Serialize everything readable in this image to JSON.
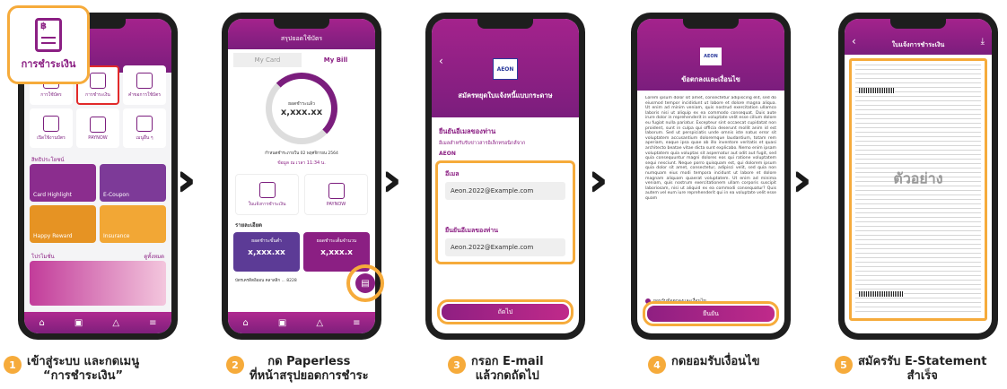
{
  "badge": {
    "label": "การชำระเงิน",
    "icon": "baht-document-icon"
  },
  "phone1": {
    "menu": [
      {
        "label": "การใช้บัตร"
      },
      {
        "label": "การชำระเงิน"
      },
      {
        "label": "คำขอการใช้บัตร"
      },
      {
        "label": "เปิดใช้งานบัตร"
      },
      {
        "label": "PAYNOW"
      },
      {
        "label": "เมนูอื่น ๆ"
      }
    ],
    "promo_title": "สิทธิประโยชน์",
    "promos": [
      {
        "label": "Card Highlight"
      },
      {
        "label": "E-Coupon"
      },
      {
        "label": "Happy Reward"
      },
      {
        "label": "Insurance"
      }
    ],
    "news_title": "โปรโมชั่น",
    "news_more": "ดูทั้งหมด"
  },
  "phone2": {
    "title": "สรุปยอดใช้บัตร",
    "tab_card": "My Card",
    "tab_bill": "My Bill",
    "ring_label": "ยอดชำระแล้ว",
    "ring_value": "x,xxx.xx",
    "due_text": "กำหนดชำระภายใน 02 พฤศจิกายน 2564",
    "update_text": "ข้อมูล ณ เวลา 11:34 น.",
    "btn_paperless": "ใบแจ้งการชำระเงิน",
    "btn_paynow": "PAYNOW",
    "detail_title": "รายละเอียด",
    "min_label": "ยอดชำระขั้นต่ำ",
    "min_value": "x,xxx.xx",
    "full_label": "ยอดชำระเต็มจำนวน",
    "full_value": "x,xxx.x",
    "footer_text": "บัตรเครดิตอิออน คลาสสิก ... 8228"
  },
  "phone3": {
    "logo": "AEON",
    "title": "สมัครหยุดใบแจ้งหนี้แบบกระดาษ",
    "confirm_title": "ยืนยันอีเมลของท่าน",
    "confirm_sub": "อีเมลสำหรับรับข่าวสารอิเล็กทรอนิกส์จาก",
    "brand": "AEON",
    "email_label": "อีเมล",
    "email_value": "Aeon.2022@Example.com",
    "confirm_label": "ยืนยันอีเมลของท่าน",
    "confirm_value": "Aeon.2022@Example.com",
    "next_button": "ถัดไป"
  },
  "phone4": {
    "logo": "AEON",
    "title": "ข้อตกลงและเงื่อนไข",
    "terms": "Lorem ipsum dolor sit amet, consectetur adipiscing elit, sed do eiusmod tempor incididunt ut labore et dolore magna aliqua. Ut enim ad minim veniam, quis nostrud exercitation ullamco laboris nisi ut aliquip ex ea commodo consequat. Duis aute irure dolor in reprehenderit in voluptate velit esse cillum dolore eu fugiat nulla pariatur. Excepteur sint occaecat cupidatat non proident, sunt in culpa qui officia deserunt mollit anim id est laborum. Sed ut perspiciatis unde omnis iste natus error sit voluptatem accusantium doloremque laudantium, totam rem aperiam, eaque ipsa quae ab illo inventore veritatis et quasi architecto beatae vitae dicta sunt explicabo. Nemo enim ipsam voluptatem quia voluptas sit aspernatur aut odit aut fugit, sed quia consequuntur magni dolores eos qui ratione voluptatem sequi nesciunt. Neque porro quisquam est, qui dolorem ipsum quia dolor sit amet, consectetur, adipisci velit, sed quia non numquam eius modi tempora incidunt ut labore et dolore magnam aliquam quaerat voluptatem. Ut enim ad minima veniam, quis nostrum exercitationem ullam corporis suscipit laboriosam, nisi ut aliquid ex ea commodi consequatur? Quis autem vel eum iure reprehenderit qui in ea voluptate velit esse quam",
    "accept_label": "ยอมรับข้อตกลงและเงื่อนไข",
    "confirm_button": "ยืนยัน"
  },
  "phone5": {
    "title": "ใบแจ้งการชำระเงิน",
    "stamp": "ตัวอย่าง"
  },
  "steps": [
    {
      "num": "1",
      "line1": "เข้าสู่ระบบ และกดเมนู",
      "line2": "“การชำระเงิน”"
    },
    {
      "num": "2",
      "line1": "กด Paperless",
      "line2": "ที่หน้าสรุปยอดการชำระ"
    },
    {
      "num": "3",
      "line1": "กรอก E-mail",
      "line2": "แล้วกดถัดไป"
    },
    {
      "num": "4",
      "line1": "กดยอมรับเงื่อนไข",
      "line2": ""
    },
    {
      "num": "5",
      "line1": "สมัครรับ E-Statement",
      "line2": "สำเร็จ"
    }
  ],
  "colors": {
    "magenta": "#8b1f83",
    "orange": "#f6ab3b",
    "bg": "#ffffff"
  }
}
